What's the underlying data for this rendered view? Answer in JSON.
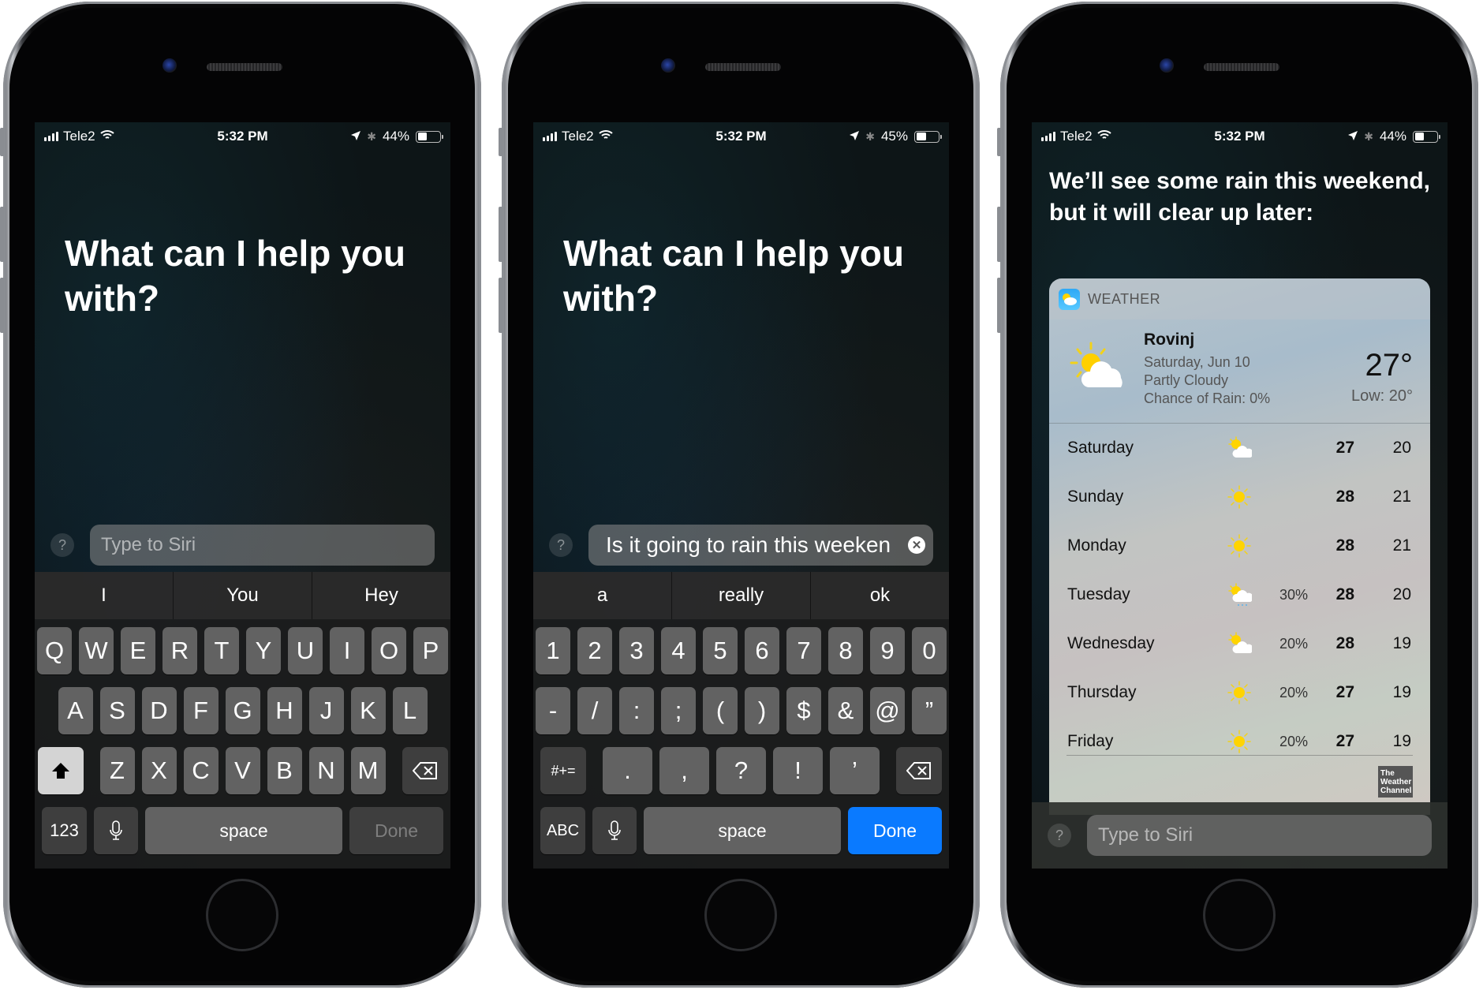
{
  "phones": [
    {
      "status": {
        "carrier": "Tele2",
        "time": "5:32 PM",
        "battery": "44%",
        "battery_level": 0.44
      },
      "prompt": "What can I help you with?",
      "input": {
        "placeholder": "Type to Siri",
        "value": ""
      },
      "help_label": "?",
      "suggestions": [
        "I",
        "You",
        "Hey"
      ],
      "keys": {
        "row1": [
          "Q",
          "W",
          "E",
          "R",
          "T",
          "Y",
          "U",
          "I",
          "O",
          "P"
        ],
        "row2": [
          "A",
          "S",
          "D",
          "F",
          "G",
          "H",
          "J",
          "K",
          "L"
        ],
        "row3": [
          "Z",
          "X",
          "C",
          "V",
          "B",
          "N",
          "M"
        ],
        "mode_label": "123",
        "space_label": "space",
        "done_label": "Done"
      }
    },
    {
      "status": {
        "carrier": "Tele2",
        "time": "5:32 PM",
        "battery": "45%",
        "battery_level": 0.45
      },
      "prompt": "What can I help you with?",
      "input": {
        "placeholder": "Type to Siri",
        "value": "Is it going to rain this weeken"
      },
      "help_label": "?",
      "suggestions": [
        "a",
        "really",
        "ok"
      ],
      "keys": {
        "row1": [
          "1",
          "2",
          "3",
          "4",
          "5",
          "6",
          "7",
          "8",
          "9",
          "0"
        ],
        "row2": [
          "-",
          "/",
          ":",
          ";",
          "(",
          ")",
          "$",
          "&",
          "@",
          "”"
        ],
        "row3": [
          ".",
          ",",
          "?",
          "!",
          "’"
        ],
        "symbols_label": "#+=",
        "mode_label": "ABC",
        "space_label": "space",
        "done_label": "Done"
      }
    },
    {
      "status": {
        "carrier": "Tele2",
        "time": "5:32 PM",
        "battery": "44%",
        "battery_level": 0.44
      },
      "answer": "We’ll see some rain this weekend, but it will clear up later:",
      "input": {
        "placeholder": "Type to Siri",
        "value": ""
      },
      "help_label": "?",
      "weather": {
        "app_label": "WEATHER",
        "city": "Rovinj",
        "date": "Saturday, Jun 10",
        "condition": "Partly Cloudy",
        "chance_of_rain": "Chance of Rain: 0%",
        "temp": "27°",
        "low": "Low: 20°",
        "forecast": [
          {
            "day": "Saturday",
            "icon": "partly-cloudy",
            "pct": "",
            "hi": "27",
            "lo": "20"
          },
          {
            "day": "Sunday",
            "icon": "sunny",
            "pct": "",
            "hi": "28",
            "lo": "21"
          },
          {
            "day": "Monday",
            "icon": "sunny",
            "pct": "",
            "hi": "28",
            "lo": "21"
          },
          {
            "day": "Tuesday",
            "icon": "rain-partly-cloudy",
            "pct": "30%",
            "hi": "28",
            "lo": "20"
          },
          {
            "day": "Wednesday",
            "icon": "partly-cloudy",
            "pct": "20%",
            "hi": "28",
            "lo": "19"
          },
          {
            "day": "Thursday",
            "icon": "sunny",
            "pct": "20%",
            "hi": "27",
            "lo": "19"
          },
          {
            "day": "Friday",
            "icon": "sunny",
            "pct": "20%",
            "hi": "27",
            "lo": "19"
          }
        ],
        "provider": "The Weather Channel"
      }
    }
  ]
}
